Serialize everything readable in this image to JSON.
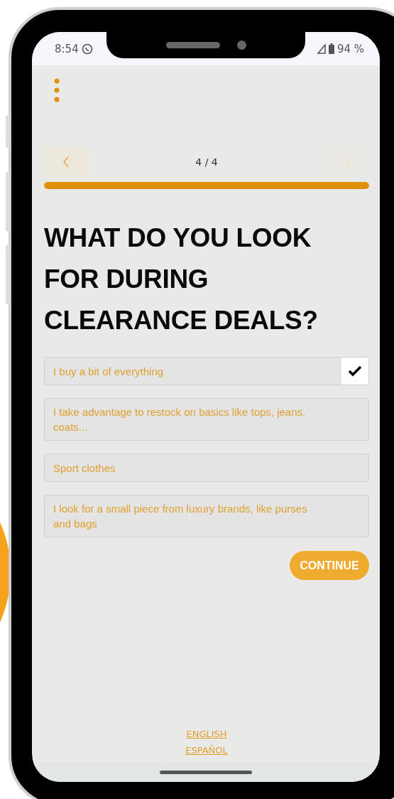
{
  "status_bar": {
    "time": "8:54",
    "battery": "94 %"
  },
  "pager": {
    "label": "4 / 4",
    "prev_disabled": false,
    "next_disabled": true
  },
  "progress": {
    "level": 1
  },
  "title": "WHAT DO YOU LOOK FOR DURING CLEARANCE DEALS?",
  "options": [
    {
      "label": "I buy a bit of everything",
      "selected": true
    },
    {
      "label": "I take advantage to restock on basics like tops, jeans, coats...",
      "selected": false
    },
    {
      "label": "Sport clothes",
      "selected": false
    },
    {
      "label": "I look for a small piece from luxury brands, like purses and bags",
      "selected": false
    }
  ],
  "continue_button": "CONTINUE",
  "languages": [
    "ENGLISH",
    "ESPAÑOL"
  ]
}
